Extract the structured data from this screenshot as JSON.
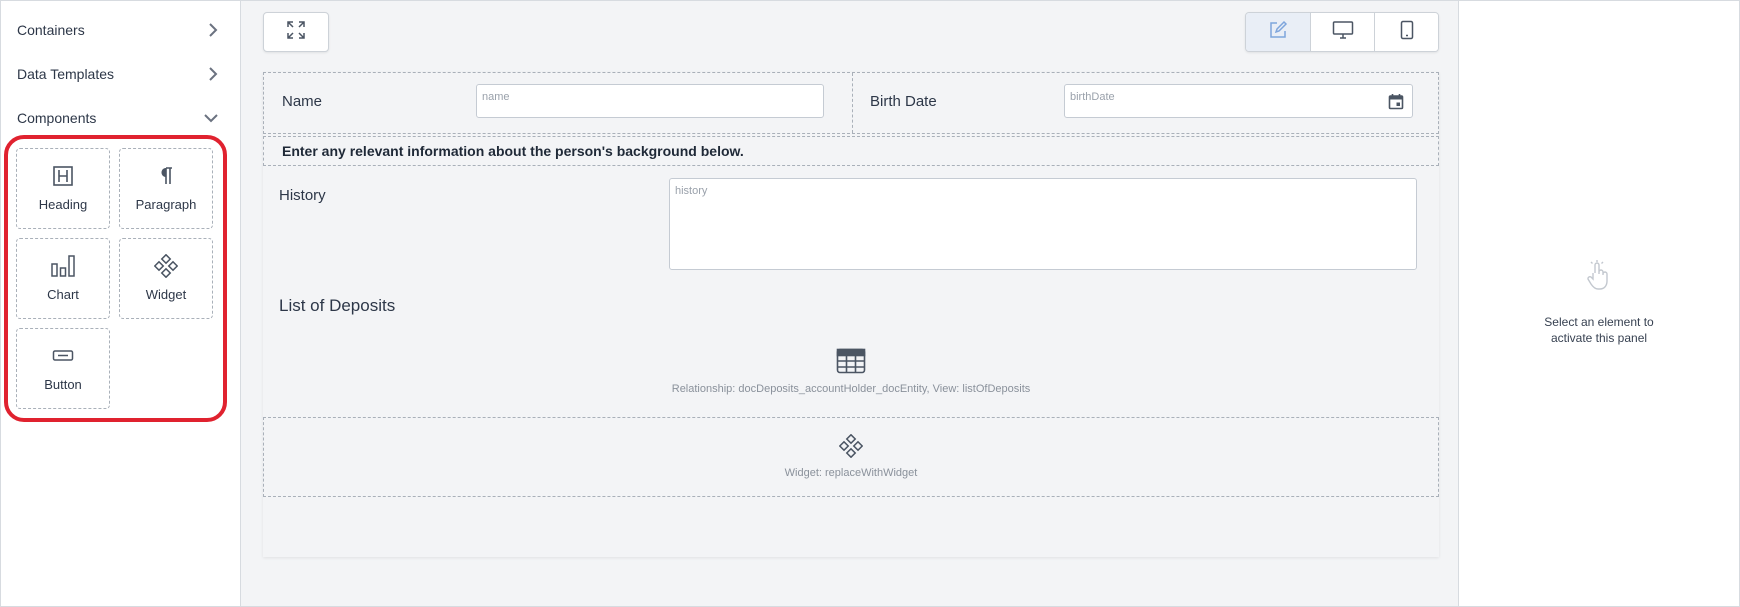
{
  "sidebar": {
    "sections": [
      {
        "label": "Containers",
        "expanded": false
      },
      {
        "label": "Data Templates",
        "expanded": false
      },
      {
        "label": "Components",
        "expanded": true
      }
    ],
    "components": [
      {
        "label": "Heading",
        "icon": "heading-icon"
      },
      {
        "label": "Paragraph",
        "icon": "paragraph-icon"
      },
      {
        "label": "Chart",
        "icon": "chart-icon"
      },
      {
        "label": "Widget",
        "icon": "widget-icon"
      },
      {
        "label": "Button",
        "icon": "button-icon"
      }
    ],
    "highlight_color": "#e0222f"
  },
  "toolbar": {
    "expand_icon": "expand-icon",
    "view_modes": [
      "edit-icon",
      "desktop-icon",
      "tablet-icon"
    ],
    "active_view": "edit"
  },
  "form": {
    "name_label": "Name",
    "name_placeholder": "name",
    "birth_label": "Birth Date",
    "birth_placeholder": "birthDate",
    "note": "Enter any relevant information about the person's background below.",
    "history_label": "History",
    "history_placeholder": "history",
    "deposits_title": "List of Deposits",
    "deposits_relationship": "Relationship: docDeposits_accountHolder_docEntity, View: listOfDeposits",
    "widget_text": "Widget: replaceWithWidget"
  },
  "right_panel": {
    "message_line1": "Select an element to",
    "message_line2": "activate this panel"
  }
}
